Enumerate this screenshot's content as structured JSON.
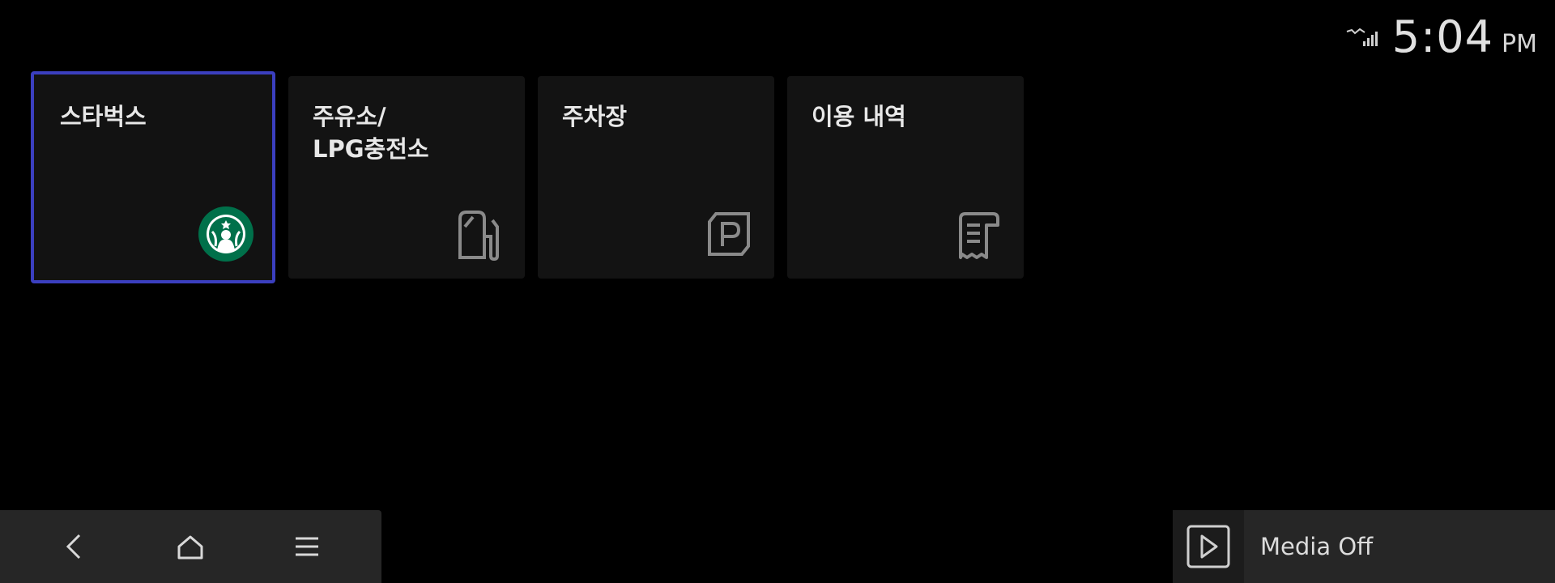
{
  "status": {
    "time": "5:04",
    "ampm": "PM",
    "signal_icon": "lte-signal-icon"
  },
  "tiles": [
    {
      "label": "스타벅스",
      "icon": "starbucks-logo",
      "focused": true
    },
    {
      "label": "주유소/\nLPG충전소",
      "icon": "fuel-pump-icon",
      "focused": false
    },
    {
      "label": "주차장",
      "icon": "parking-icon",
      "focused": false
    },
    {
      "label": "이용 내역",
      "icon": "receipt-icon",
      "focused": false
    }
  ],
  "navbar": {
    "back_icon": "back-chevron-icon",
    "home_icon": "home-icon",
    "menu_icon": "menu-icon"
  },
  "media": {
    "label": "Media Off",
    "icon": "play-icon"
  },
  "colors": {
    "background": "#000000",
    "tile": "#131313",
    "focus_border": "#3b3fbf",
    "bar": "#262626",
    "starbucks_green": "#00704a"
  }
}
